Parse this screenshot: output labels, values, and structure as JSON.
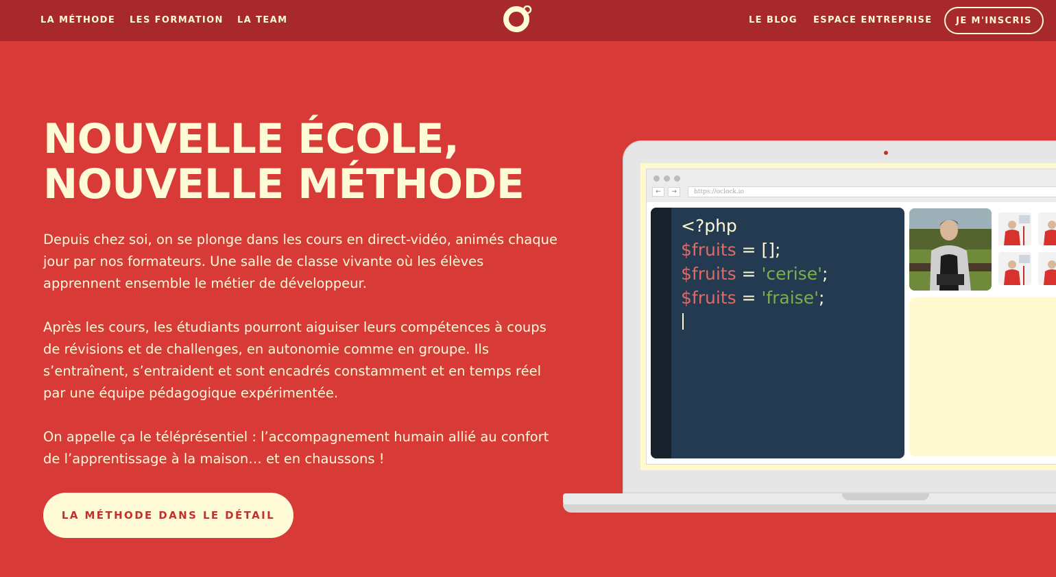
{
  "nav": {
    "left_links": [
      "LA MÉTHODE",
      "LES FORMATION",
      "LA TEAM"
    ],
    "right_links": [
      "LE BLOG",
      "ESPACE ENTREPRISE"
    ],
    "cta": "JE M'INSCRIS",
    "logo_icon": "oclock-logo-icon"
  },
  "hero": {
    "title_line1": "NOUVELLE ÉCOLE,",
    "title_line2": "NOUVELLE MÉTHODE",
    "paragraph1": "Depuis chez soi, on se plonge dans les cours en direct-vidéo, animés chaque jour par nos formateurs. Une salle de classe vivante où les élèves apprennent ensemble le métier de développeur.",
    "paragraph2": "Après les cours, les étudiants pourront aiguiser leurs compétences à coups de révisions et de challenges, en autonomie comme en groupe. Ils s’entraînent, s’entraident et sont encadrés constamment et en temps réel par une équipe pédagogique expérimentée.",
    "paragraph3": "On appelle ça le téléprésentiel : l’accompagnement humain allié au confort de l’apprentissage à la maison… et en chaussons !",
    "button": "LA MÉTHODE DANS LE DÉTAIL"
  },
  "laptop": {
    "url": "https://oclock.io",
    "back_icon": "←",
    "forward_icon": "→",
    "code": {
      "line1": "<?php",
      "line2_var": "$fruits",
      "line2_rest": " = [];",
      "line3_var": "$fruits",
      "line3_eq": " = ",
      "line3_str": "'cerise'",
      "line3_end": ";",
      "line4_var": "$fruits",
      "line4_eq": " = ",
      "line4_str": "'fraise'",
      "line4_end": ";"
    }
  },
  "colors": {
    "background": "#d83a38",
    "nav": "#a8292b",
    "cream": "#fffbd6",
    "code_bg": "#243a50"
  }
}
